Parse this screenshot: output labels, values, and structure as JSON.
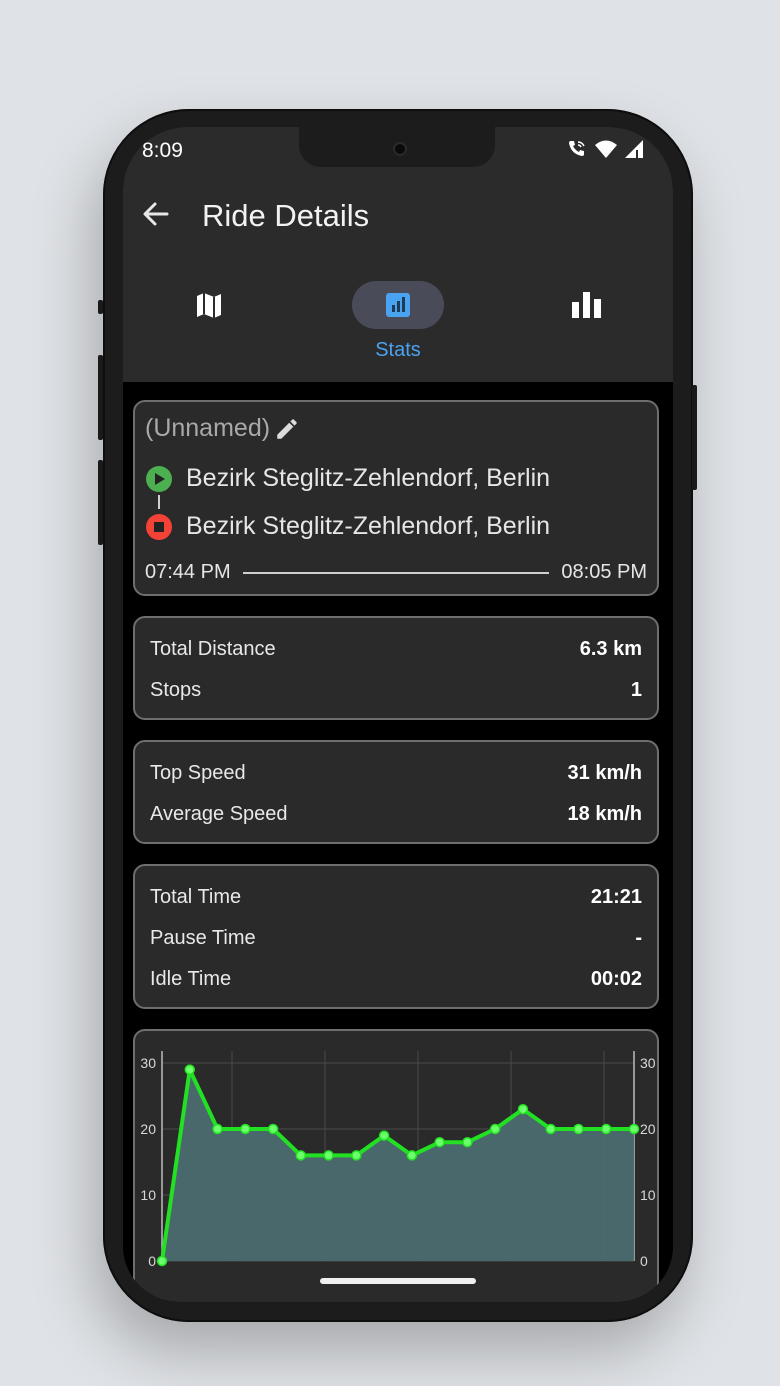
{
  "status": {
    "time": "8:09"
  },
  "header": {
    "title": "Ride Details"
  },
  "nav": {
    "items": [
      {
        "icon": "map-icon"
      },
      {
        "icon": "stats-icon",
        "label": "Stats",
        "active": true
      },
      {
        "icon": "bar-chart-icon"
      }
    ]
  },
  "ride": {
    "name": "(Unnamed)",
    "start_location": "Bezirk Steglitz-Zehlendorf, Berlin",
    "end_location": "Bezirk Steglitz-Zehlendorf, Berlin",
    "start_time": "07:44 PM",
    "end_time": "08:05 PM"
  },
  "stats": {
    "distance": [
      {
        "label": "Total Distance",
        "value": "6.3 km"
      },
      {
        "label": "Stops",
        "value": "1"
      }
    ],
    "speed": [
      {
        "label": "Top Speed",
        "value": "31 km/h"
      },
      {
        "label": "Average Speed",
        "value": "18 km/h"
      }
    ],
    "time": [
      {
        "label": "Total Time",
        "value": "21:21"
      },
      {
        "label": "Pause Time",
        "value": "-"
      },
      {
        "label": "Idle Time",
        "value": "00:02"
      }
    ]
  },
  "colors": {
    "accent": "#4aa3f0",
    "start": "#4caf50",
    "end": "#f44336",
    "line": "#22e022",
    "area": "#4a6b70"
  },
  "chart_data": {
    "type": "area",
    "y_ticks_left": [
      "0",
      "10",
      "20",
      "30"
    ],
    "y_ticks_right": [
      "0",
      "10",
      "20",
      "30"
    ],
    "ylim": [
      0,
      30
    ],
    "grid": true,
    "values": [
      0,
      29,
      20,
      20,
      20,
      16,
      16,
      16,
      19,
      16,
      18,
      18,
      20,
      23,
      20,
      20,
      20,
      20
    ]
  }
}
